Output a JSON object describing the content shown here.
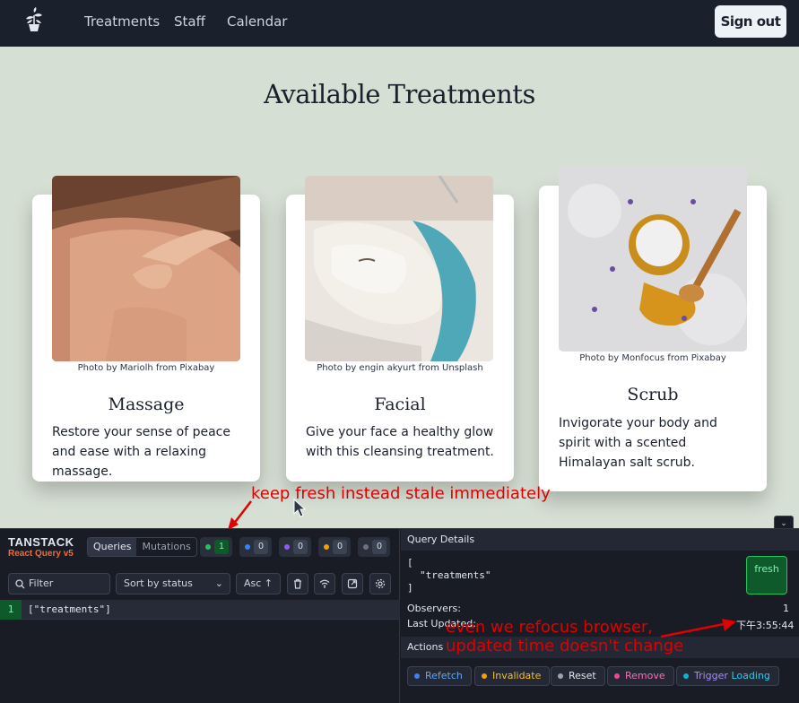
{
  "nav": {
    "links": [
      "Treatments",
      "Staff",
      "Calendar"
    ],
    "signout": "Sign out"
  },
  "page": {
    "title": "Available Treatments"
  },
  "cards": [
    {
      "credit": "Photo by Mariolh from Pixabay",
      "title": "Massage",
      "desc": "Restore your sense of peace and ease with a relaxing massage."
    },
    {
      "credit": "Photo by engin akyurt from Unsplash",
      "title": "Facial",
      "desc": "Give your face a healthy glow with this cleansing treatment."
    },
    {
      "credit": "Photo by Monfocus from Pixabay",
      "title": "Scrub",
      "desc": "Invigorate your body and spirit with a scented Himalayan salt scrub."
    }
  ],
  "annotations": {
    "top": "keep fresh instead stale immediately",
    "bottom_line1": "even we refocus browser,",
    "bottom_line2": "updated time doesn't change",
    "color": "#e00000"
  },
  "devtools": {
    "brand": "TANSTACK",
    "subbrand": "React Query v5",
    "tabs": [
      "Queries",
      "Mutations"
    ],
    "counts": [
      {
        "value": "1",
        "color": "#22c55e"
      },
      {
        "value": "0",
        "color": "#3b82f6"
      },
      {
        "value": "0",
        "color": "#8b5cf6"
      },
      {
        "value": "0",
        "color": "#f59e0b"
      },
      {
        "value": "0",
        "color": "#6b7280"
      }
    ],
    "filter_placeholder": "Filter",
    "sort": "Sort by status",
    "order": "Asc",
    "query": {
      "observers": "1",
      "key": "[\"treatments\"]"
    },
    "details": {
      "header": "Query Details",
      "line1": "[",
      "line2": "\"treatments\"",
      "line3": "]",
      "status": "fresh",
      "observers_label": "Observers:",
      "observers": "1",
      "updated_label": "Last Updated:",
      "updated": "下午3:55:44",
      "actions_header": "Actions",
      "actions": [
        {
          "label": "Refetch",
          "color": "#3b82f6"
        },
        {
          "label": "Invalidate",
          "color": "#f59e0b"
        },
        {
          "label": "Reset",
          "color": "#9ca3af"
        },
        {
          "label": "Remove",
          "color": "#ec4899"
        },
        {
          "label": "Trigger",
          "color": "#06b6d4"
        }
      ],
      "loading": "Loading"
    }
  }
}
